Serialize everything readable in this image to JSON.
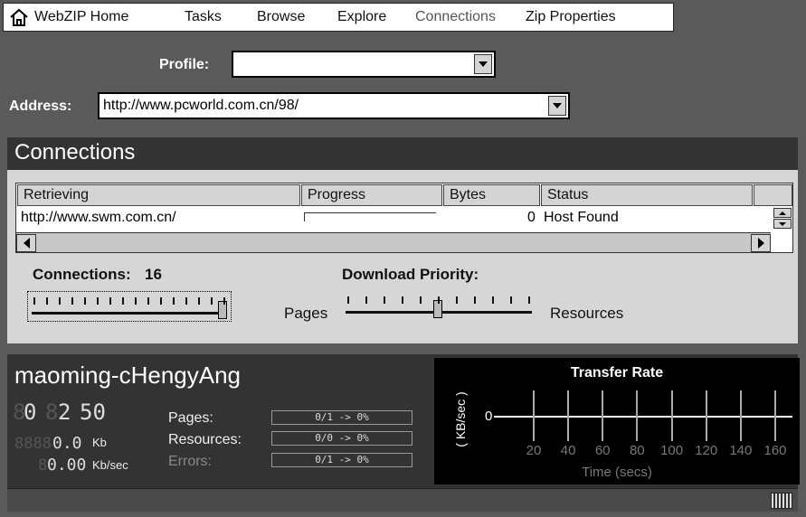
{
  "menu": {
    "home": "WebZIP Home",
    "tasks": "Tasks",
    "browse": "Browse",
    "explore": "Explore",
    "connections": "Connections",
    "zip_properties": "Zip Properties"
  },
  "profile": {
    "label": "Profile:",
    "value": ""
  },
  "address": {
    "label": "Address:",
    "value": "http://www.pcworld.com.cn/98/"
  },
  "connections_panel": {
    "title": "Connections",
    "columns": [
      "Retrieving",
      "Progress",
      "Bytes",
      "Status"
    ],
    "rows": [
      {
        "retrieving": "http://www.swm.com.cn/",
        "progress": 0,
        "bytes": "0",
        "status": "Host Found"
      }
    ],
    "connections_label": "Connections:",
    "connections_value": "16",
    "connections_slider_level": 1.0,
    "priority_label": "Download Priority:",
    "priority_left": "Pages",
    "priority_right": "Resources",
    "priority_slider_level": 0.5
  },
  "status": {
    "site": "maoming-cHengyAng",
    "time": {
      "hours": "0",
      "minutes": "2",
      "seconds": "50"
    },
    "bytes_value": "0.0",
    "bytes_unit": "Kb",
    "rate_value": "0.00",
    "rate_unit": "Kb/sec",
    "pages_label": "Pages:",
    "pages_value": "0/1 -> 0%",
    "resources_label": "Resources:",
    "resources_value": "0/0 -> 0%",
    "errors_label": "Errors:",
    "errors_value": "0/1 -> 0%"
  },
  "chart_data": {
    "type": "line",
    "title": "Transfer Rate",
    "xlabel": "Time (secs)",
    "ylabel": "( KB/sec )",
    "x_ticks": [
      "20",
      "40",
      "60",
      "80",
      "100",
      "120",
      "140",
      "160"
    ],
    "y_ticks": [
      "0"
    ],
    "series": [
      {
        "values": [
          0,
          0,
          0,
          0,
          0,
          0,
          0,
          0
        ]
      }
    ],
    "xlim": [
      0,
      170
    ],
    "grid": true
  },
  "colors": {
    "background": "#5a5a5a",
    "panel_dark": "#333333",
    "panel_light": "#d6d6d6"
  }
}
